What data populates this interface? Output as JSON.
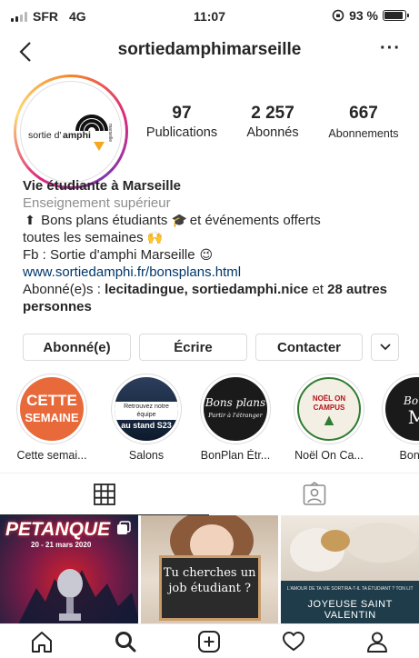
{
  "status_bar": {
    "carrier": "SFR",
    "network": "4G",
    "time": "11:07",
    "battery": "93 %",
    "battery_level": 0.93
  },
  "nav": {
    "back_icon": "chevron-left-icon",
    "username": "sortiedamphimarseille",
    "more_icon": "ellipsis-icon"
  },
  "avatar": {
    "logo_text_1": "sortie d'",
    "logo_text_2": "amphi",
    "logo_side_text": "marseille"
  },
  "stats": [
    {
      "value": "97",
      "label": "Publications"
    },
    {
      "value": "2 257",
      "label": "Abonnés"
    },
    {
      "value": "667",
      "label": "Abonnements"
    }
  ],
  "bio": {
    "name": "Vie étudiante à Marseille",
    "category": "Enseignement supérieur",
    "line1": "Bons plans étudiants",
    "line1b": "et événements offerts",
    "line2": "toutes les semaines",
    "line3": "Fb : Sortie d'amphi Marseille",
    "link": "www.sortiedamphi.fr/bonsplans.html",
    "followed_prefix": "Abonné(e)s :",
    "followed_names": "lecitadingue, sortiedamphi.nice",
    "followed_and": "et",
    "followed_more": "28 autres personnes"
  },
  "actions": {
    "follow": "Abonné(e)",
    "message": "Écrire",
    "contact": "Contacter"
  },
  "highlights": [
    {
      "caption": "Cette semai...",
      "text_top": "CETTE",
      "text_bottom": "SEMAINE"
    },
    {
      "caption": "Salons",
      "text_top": "Retrouvez notre équipe",
      "text_bottom": "au stand S23"
    },
    {
      "caption": "BonPlan Étr...",
      "text_top": "Bons plans",
      "text_bottom": "Partir à l'étranger"
    },
    {
      "caption": "Noël On Ca...",
      "text_top": "NOËL ON CAMPUS",
      "text_bottom": ""
    },
    {
      "caption": "Bons p",
      "text_top": "Bons",
      "text_bottom": "M"
    }
  ],
  "posts": [
    {
      "title": "PETANQUE",
      "subtitle": "20 - 21 mars 2020"
    },
    {
      "title": "Tu cherches un job étudiant ?"
    },
    {
      "title": "JOYEUSE SAINT VALENTIN",
      "subtitle": "L'AMOUR DE TA VIE SORTIRA-T-IL TA ÉTUDIANT ? TON LIT"
    }
  ],
  "colors": {
    "text": "#262626",
    "muted": "#8e8e8e",
    "link": "#00376b",
    "border": "#dbdbdb"
  }
}
